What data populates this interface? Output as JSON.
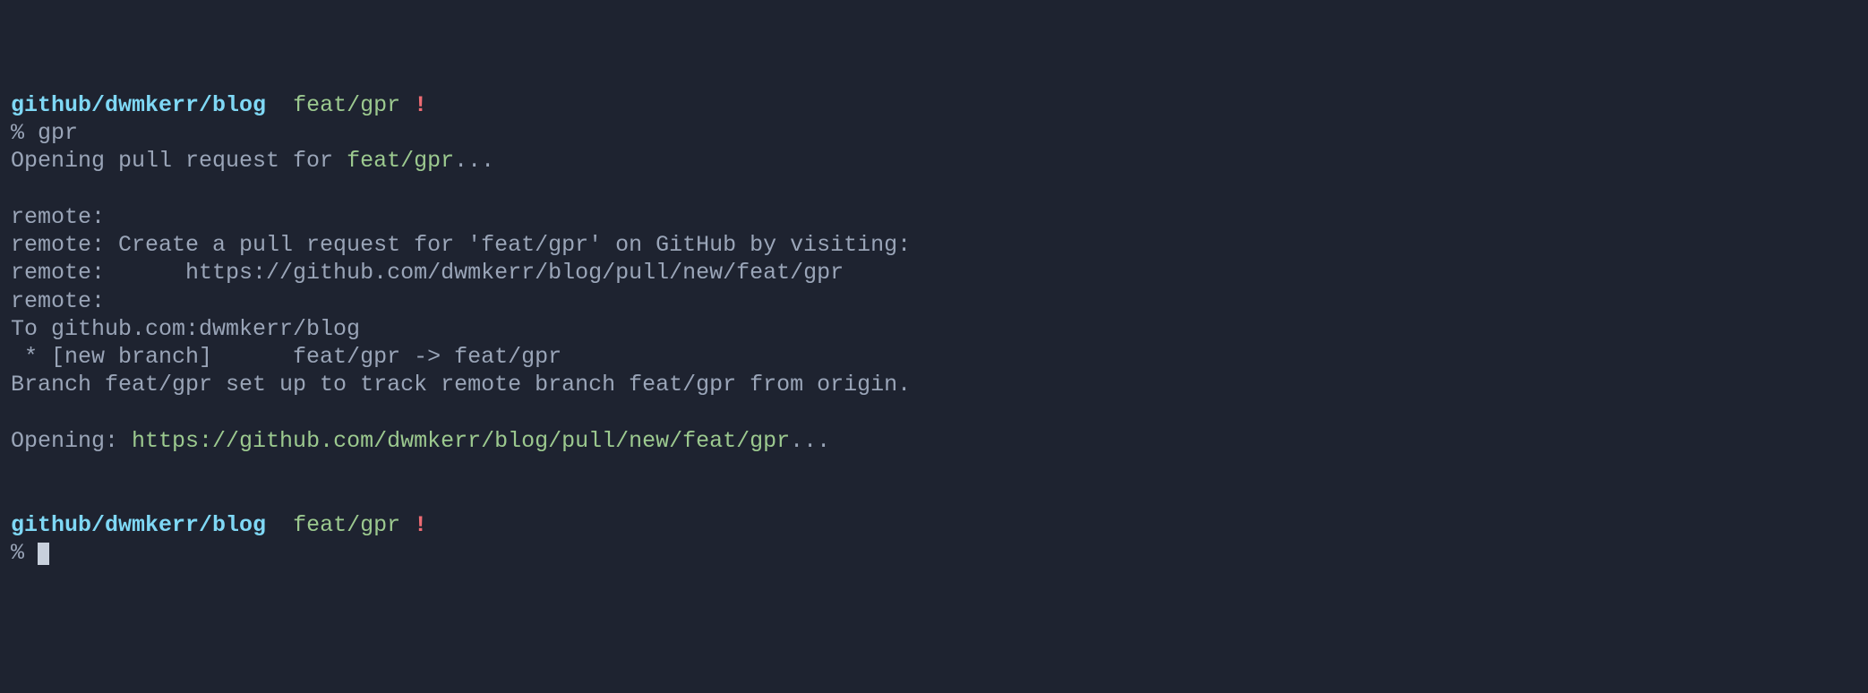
{
  "prompt1": {
    "path": "github/dwmkerr/blog",
    "branch": "feat/gpr",
    "dirty_marker": "!",
    "symbol": "%",
    "command": "gpr"
  },
  "output": {
    "opening_prefix": "Opening pull request for ",
    "opening_branch": "feat/gpr",
    "opening_ellipsis": "...",
    "remote_1": "remote:",
    "remote_2": "remote: Create a pull request for 'feat/gpr' on GitHub by visiting:",
    "remote_3": "remote:      https://github.com/dwmkerr/blog/pull/new/feat/gpr",
    "remote_4": "remote:",
    "to_line": "To github.com:dwmkerr/blog",
    "newbranch_line": " * [new branch]      feat/gpr -> feat/gpr",
    "track_line": "Branch feat/gpr set up to track remote branch feat/gpr from origin.",
    "opening2_prefix": "Opening: ",
    "opening2_url": "https://github.com/dwmkerr/blog/pull/new/feat/gpr",
    "opening2_ellipsis": "..."
  },
  "prompt2": {
    "path": "github/dwmkerr/blog",
    "branch": "feat/gpr",
    "dirty_marker": "!",
    "symbol": "%"
  }
}
